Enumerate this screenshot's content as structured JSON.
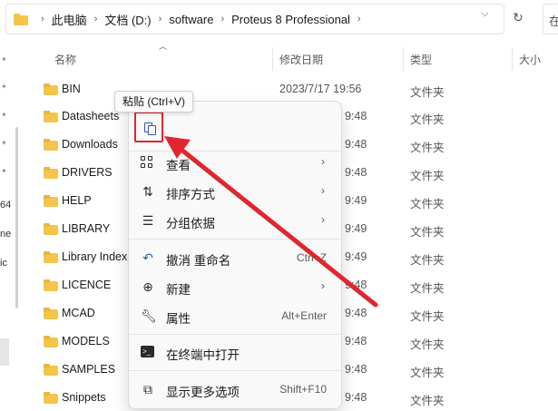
{
  "address_bar": {
    "crumbs": [
      "此电脑",
      "文档 (D:)",
      "software",
      "Proteus 8 Professional"
    ]
  },
  "nav_fragments": [
    "64",
    "ne",
    "ic"
  ],
  "columns": {
    "name": "名称",
    "date": "修改日期",
    "type": "类型",
    "size": "大小"
  },
  "files": [
    {
      "name": "BIN",
      "date": "2023/7/17 19:56",
      "type": "文件夹"
    },
    {
      "name": "Datasheets",
      "date": "9:48",
      "type": "文件夹"
    },
    {
      "name": "Downloads",
      "date": "9:48",
      "type": "文件夹"
    },
    {
      "name": "DRIVERS",
      "date": "9:48",
      "type": "文件夹"
    },
    {
      "name": "HELP",
      "date": "9:49",
      "type": "文件夹"
    },
    {
      "name": "LIBRARY",
      "date": "9:49",
      "type": "文件夹"
    },
    {
      "name": "Library Index",
      "date": "9:49",
      "type": "文件夹"
    },
    {
      "name": "LICENCE",
      "date": "9:48",
      "type": "文件夹"
    },
    {
      "name": "MCAD",
      "date": "9:48",
      "type": "文件夹"
    },
    {
      "name": "MODELS",
      "date": "9:48",
      "type": "文件夹"
    },
    {
      "name": "SAMPLES",
      "date": "9:48",
      "type": "文件夹"
    },
    {
      "name": "Snippets",
      "date": "9:48",
      "type": "文件夹"
    }
  ],
  "tooltip": "粘贴 (Ctrl+V)",
  "context_menu": {
    "items": [
      {
        "label": "查看",
        "icon": "grid-icon",
        "shortcut": ""
      },
      {
        "label": "排序方式",
        "icon": "sort-icon",
        "shortcut": ""
      },
      {
        "label": "分组依据",
        "icon": "group-icon",
        "shortcut": ""
      },
      {
        "label": "撤消 重命名",
        "icon": "undo-icon",
        "shortcut": "Ctrl+Z"
      },
      {
        "label": "新建",
        "icon": "add-icon",
        "shortcut": ""
      },
      {
        "label": "属性",
        "icon": "wrench-icon",
        "shortcut": "Alt+Enter"
      },
      {
        "label": "在终端中打开",
        "icon": "terminal-icon",
        "shortcut": ""
      },
      {
        "label": "显示更多选项",
        "icon": "more-options-icon",
        "shortcut": "Shift+F10"
      }
    ]
  },
  "colors": {
    "folder": "#f4c54d",
    "annotation": "#e0262f",
    "accent_icon": "#2f5da8"
  }
}
